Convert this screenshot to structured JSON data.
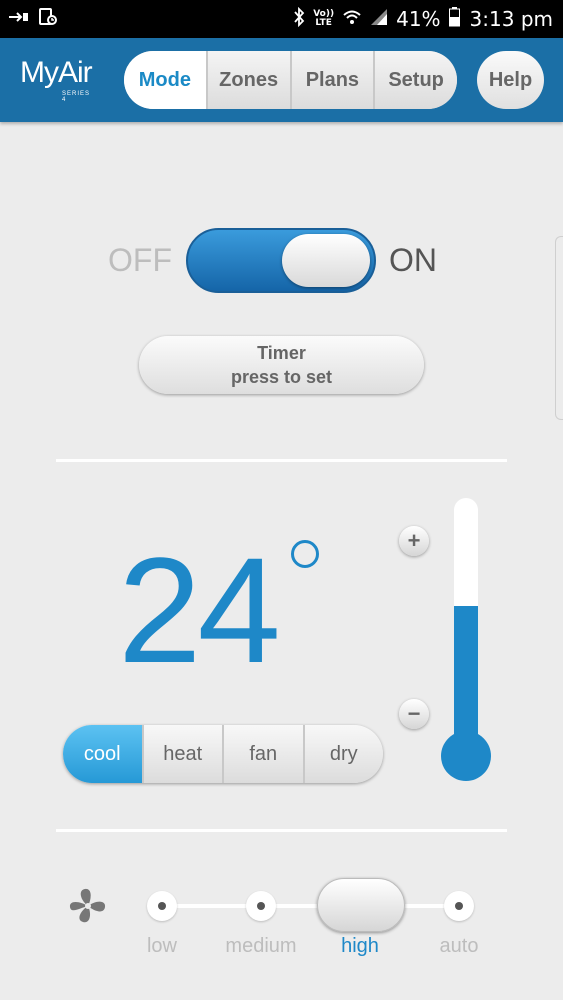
{
  "status_bar": {
    "battery_percent": "41%",
    "time": "3:13 pm",
    "network": "LTE",
    "volte": "Vo))",
    "icons": [
      "usb-debug-icon",
      "screenshot-icon",
      "bluetooth-icon",
      "volte-icon",
      "wifi-icon",
      "signal-icon",
      "battery-icon"
    ]
  },
  "header": {
    "logo_text": "MyAir",
    "logo_sub": "SERIES 4",
    "tabs": [
      {
        "label": "Mode",
        "active": true
      },
      {
        "label": "Zones",
        "active": false
      },
      {
        "label": "Plans",
        "active": false
      },
      {
        "label": "Setup",
        "active": false
      }
    ],
    "help_label": "Help",
    "accent_color": "#1b6fa6"
  },
  "power": {
    "off_label": "OFF",
    "on_label": "ON",
    "state": "on"
  },
  "timer": {
    "title": "Timer",
    "subtitle": "press to set"
  },
  "temperature": {
    "value": "24",
    "unit_symbol": "°",
    "plus_label": "+",
    "minus_label": "−",
    "thermometer_level": 0.6,
    "color": "#1e88c8"
  },
  "modes": [
    {
      "label": "cool",
      "active": true
    },
    {
      "label": "heat",
      "active": false
    },
    {
      "label": "fan",
      "active": false
    },
    {
      "label": "dry",
      "active": false
    }
  ],
  "fan_speed": {
    "icon": "fan-icon",
    "options": [
      {
        "label": "low",
        "active": false
      },
      {
        "label": "medium",
        "active": false
      },
      {
        "label": "high",
        "active": true
      },
      {
        "label": "auto",
        "active": false
      }
    ],
    "selected": "high"
  }
}
